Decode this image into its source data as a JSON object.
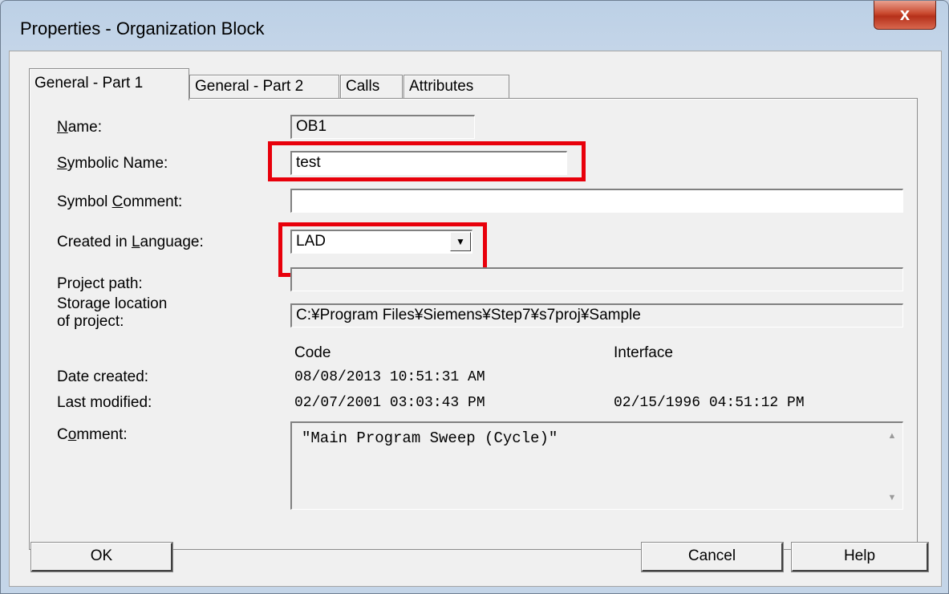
{
  "window": {
    "title": "Properties - Organization Block",
    "close_label": "x"
  },
  "tabs": [
    {
      "label": "General - Part 1",
      "active": true
    },
    {
      "label": "General - Part 2",
      "active": false
    },
    {
      "label": "Calls",
      "active": false
    },
    {
      "label": "Attributes",
      "active": false
    }
  ],
  "fields": {
    "name_label_u": "N",
    "name_label_rest": "ame:",
    "name_value": "OB1",
    "symbolic_label_u": "S",
    "symbolic_label_rest": "ymbolic Name:",
    "symbolic_value": "test",
    "symbol_comment_label_pre": "Symbol ",
    "symbol_comment_label_u": "C",
    "symbol_comment_label_rest": "omment:",
    "symbol_comment_value": "",
    "language_label_pre": "Created in ",
    "language_label_u": "L",
    "language_label_rest": "anguage:",
    "language_value": "LAD",
    "project_path_label": "Project path:",
    "project_path_value": "",
    "storage_label_line1": "Storage location",
    "storage_label_line2": "of project:",
    "storage_value": "C:¥Program Files¥Siemens¥Step7¥s7proj¥Sample"
  },
  "dates": {
    "code_header": "Code",
    "interface_header": "Interface",
    "created_label": "Date created:",
    "created_code": "08/08/2013 10:51:31 AM",
    "modified_label": "Last modified:",
    "modified_code": "02/07/2001 03:03:43 PM",
    "modified_interface": "02/15/1996 04:51:12 PM"
  },
  "comment": {
    "label_pre": "C",
    "label_u": "o",
    "label_rest": "mment:",
    "value": "\"Main Program Sweep (Cycle)\""
  },
  "buttons": {
    "ok": "OK",
    "cancel": "Cancel",
    "help": "Help"
  },
  "highlight_color": "#e8000b"
}
